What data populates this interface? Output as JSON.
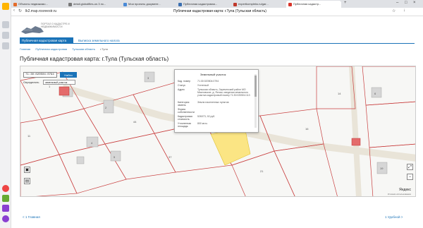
{
  "browser": {
    "tabs": [
      {
        "label": "Объекты недвижимо...",
        "favicon_color": "#e36b2a"
      },
      {
        "label": "detail.globalfiles-on.3 лс...",
        "favicon_color": "#777"
      },
      {
        "label": "Мои проекты документ...",
        "favicon_color": "#4a8ad6"
      },
      {
        "label": "Публичная кадастровая...",
        "favicon_color": "#3b6fb0"
      },
      {
        "label": "expertkompleks.ru/gar...",
        "favicon_color": "#c0392b"
      },
      {
        "label": "Публичная кадастр...",
        "favicon_color": "#d8342a",
        "active": true
      }
    ],
    "address": "lk2.map.rosreestr.ru",
    "page_title": "Публичная кадастровая карта: г.Тула (Тульская область)"
  },
  "site": {
    "logo_text": "ПОРТАЛ О КАДАСТРЕ И НЕДВИЖИМОСТИ",
    "nav_tab1": "Публичная кадастровая карта",
    "nav_tab2": "Выписка земельного налога",
    "breadcrumbs": [
      "Главная",
      "Публичная кадастровая",
      "Тульская область",
      "г.Тула"
    ],
    "title": "Публичная кадастровая карта: г.Тула (Тульская область)",
    "search_value": "71:30:020504:0794",
    "search_button": "Найти",
    "define_label": "Определять",
    "define_option": "земельный участок"
  },
  "popup": {
    "heading": "Земельный участок",
    "rows": [
      {
        "k": "Кад. номер",
        "v": "71:30:020504:0794"
      },
      {
        "k": "Статус",
        "v": "Учтенный"
      },
      {
        "k": "Адрес",
        "v": "Тульская область, Зареченский район МО Мясновское, д. Ясная, сведения земельного участка кадастровый номер 71:30:020504:113"
      },
      {
        "k": "Категория земель",
        "v": "Земли населенных пунктов"
      },
      {
        "k": "Форма собственности",
        "v": ""
      },
      {
        "k": "Кадастровая стоимость",
        "v": "526073, 92 руб."
      },
      {
        "k": "Уточненная площадь",
        "v": "800 кв.м."
      }
    ]
  },
  "map": {
    "parcel_labels": [
      "1",
      "2",
      "3",
      "4",
      "5",
      "6",
      "11",
      "14",
      "16",
      "19",
      "21",
      "37",
      "44"
    ],
    "yandex": "Яндекс",
    "yandex_sub": "Условия использования"
  },
  "pager": {
    "prev": "< 1 Главная",
    "next": "1 Удобной >"
  }
}
